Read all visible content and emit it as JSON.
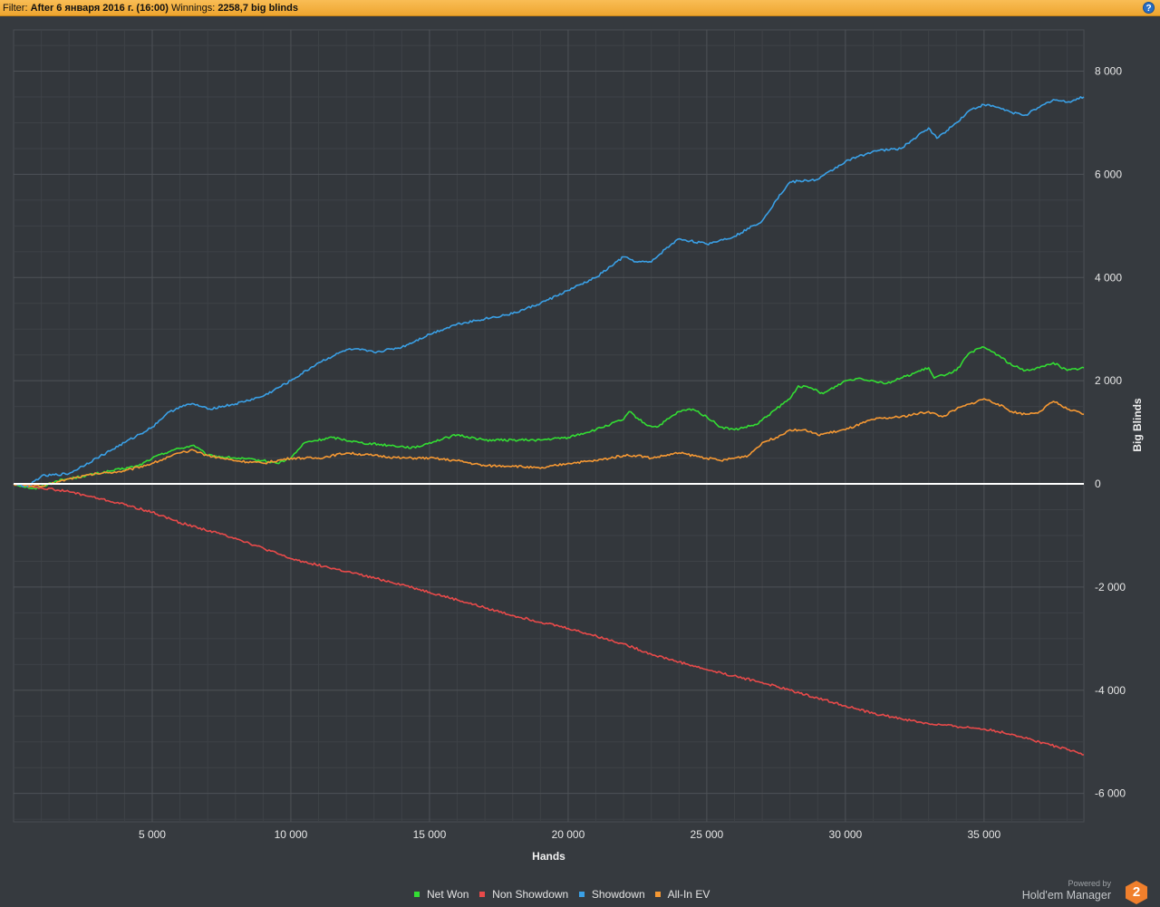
{
  "filter": {
    "label": "Filter:",
    "value": "After 6 января 2016 г. (16:00)",
    "winnings_label": "Winnings:",
    "winnings_value": "2258,7 big blinds"
  },
  "help_icon": {
    "icon": "question-icon",
    "glyph": "?"
  },
  "chart_data": {
    "type": "line",
    "title": "",
    "xlabel": "Hands",
    "ylabel": "Big Blinds",
    "xlim": [
      0,
      38600
    ],
    "ylim": [
      -6550,
      8800
    ],
    "x_ticks": [
      5000,
      10000,
      15000,
      20000,
      25000,
      30000,
      35000
    ],
    "x_tick_labels": [
      "5 000",
      "10 000",
      "15 000",
      "20 000",
      "25 000",
      "30 000",
      "35 000"
    ],
    "y_ticks": [
      8000,
      6000,
      4000,
      2000,
      0,
      -2000,
      -4000,
      -6000
    ],
    "y_tick_labels": [
      "8 000",
      "6 000",
      "4 000",
      "2 000",
      "0",
      "-2 000",
      "-4 000",
      "-6 000"
    ],
    "grid": true,
    "legend_position": "bottom",
    "series": [
      {
        "name": "Net Won",
        "color": "#33dd33",
        "points": [
          [
            0,
            0
          ],
          [
            800,
            -100
          ],
          [
            1500,
            50
          ],
          [
            2500,
            150
          ],
          [
            3500,
            250
          ],
          [
            4500,
            350
          ],
          [
            5000,
            500
          ],
          [
            5700,
            650
          ],
          [
            6500,
            750
          ],
          [
            7000,
            550
          ],
          [
            8000,
            500
          ],
          [
            9000,
            450
          ],
          [
            9500,
            400
          ],
          [
            10000,
            500
          ],
          [
            10500,
            800
          ],
          [
            11500,
            900
          ],
          [
            12500,
            800
          ],
          [
            13500,
            750
          ],
          [
            14500,
            700
          ],
          [
            15000,
            800
          ],
          [
            16000,
            950
          ],
          [
            17000,
            850
          ],
          [
            18000,
            850
          ],
          [
            19000,
            850
          ],
          [
            20000,
            900
          ],
          [
            21000,
            1050
          ],
          [
            22000,
            1250
          ],
          [
            22200,
            1400
          ],
          [
            22800,
            1150
          ],
          [
            23200,
            1100
          ],
          [
            24000,
            1400
          ],
          [
            24500,
            1450
          ],
          [
            25000,
            1300
          ],
          [
            25500,
            1100
          ],
          [
            26000,
            1050
          ],
          [
            26800,
            1150
          ],
          [
            27500,
            1450
          ],
          [
            28000,
            1650
          ],
          [
            28300,
            1900
          ],
          [
            28800,
            1850
          ],
          [
            29200,
            1750
          ],
          [
            30000,
            2000
          ],
          [
            30500,
            2050
          ],
          [
            31000,
            2000
          ],
          [
            31500,
            1950
          ],
          [
            32000,
            2050
          ],
          [
            33000,
            2250
          ],
          [
            33200,
            2050
          ],
          [
            34000,
            2200
          ],
          [
            34500,
            2550
          ],
          [
            35000,
            2650
          ],
          [
            35500,
            2500
          ],
          [
            36000,
            2300
          ],
          [
            36500,
            2200
          ],
          [
            37000,
            2250
          ],
          [
            37500,
            2350
          ],
          [
            38000,
            2200
          ],
          [
            38600,
            2250
          ]
        ]
      },
      {
        "name": "Non Showdown",
        "color": "#e84a4a",
        "points": [
          [
            0,
            0
          ],
          [
            2000,
            -150
          ],
          [
            4000,
            -400
          ],
          [
            5000,
            -550
          ],
          [
            6000,
            -750
          ],
          [
            8000,
            -1050
          ],
          [
            10000,
            -1450
          ],
          [
            12000,
            -1700
          ],
          [
            14000,
            -1950
          ],
          [
            15000,
            -2100
          ],
          [
            16000,
            -2250
          ],
          [
            18000,
            -2550
          ],
          [
            20000,
            -2800
          ],
          [
            22000,
            -3100
          ],
          [
            23000,
            -3300
          ],
          [
            24000,
            -3450
          ],
          [
            25000,
            -3600
          ],
          [
            27000,
            -3850
          ],
          [
            28000,
            -4000
          ],
          [
            29000,
            -4150
          ],
          [
            30000,
            -4300
          ],
          [
            31000,
            -4450
          ],
          [
            32000,
            -4550
          ],
          [
            33000,
            -4650
          ],
          [
            34000,
            -4700
          ],
          [
            35000,
            -4750
          ],
          [
            36000,
            -4850
          ],
          [
            37000,
            -5000
          ],
          [
            38000,
            -5150
          ],
          [
            38600,
            -5250
          ]
        ]
      },
      {
        "name": "Showdown",
        "color": "#3aa0e6",
        "points": [
          [
            0,
            0
          ],
          [
            500,
            -50
          ],
          [
            1000,
            150
          ],
          [
            2000,
            200
          ],
          [
            3000,
            500
          ],
          [
            4000,
            800
          ],
          [
            5000,
            1100
          ],
          [
            5500,
            1350
          ],
          [
            6000,
            1500
          ],
          [
            6500,
            1550
          ],
          [
            7000,
            1450
          ],
          [
            8000,
            1550
          ],
          [
            9000,
            1700
          ],
          [
            10000,
            2000
          ],
          [
            11000,
            2350
          ],
          [
            12000,
            2600
          ],
          [
            12500,
            2600
          ],
          [
            13000,
            2550
          ],
          [
            14000,
            2650
          ],
          [
            15000,
            2900
          ],
          [
            16000,
            3100
          ],
          [
            17000,
            3200
          ],
          [
            18000,
            3300
          ],
          [
            19000,
            3500
          ],
          [
            20000,
            3750
          ],
          [
            21000,
            4000
          ],
          [
            22000,
            4400
          ],
          [
            22500,
            4300
          ],
          [
            23000,
            4300
          ],
          [
            23500,
            4550
          ],
          [
            24000,
            4750
          ],
          [
            25000,
            4650
          ],
          [
            26000,
            4800
          ],
          [
            27000,
            5100
          ],
          [
            27500,
            5500
          ],
          [
            28000,
            5850
          ],
          [
            29000,
            5900
          ],
          [
            30000,
            6250
          ],
          [
            31000,
            6450
          ],
          [
            32000,
            6500
          ],
          [
            33000,
            6900
          ],
          [
            33300,
            6700
          ],
          [
            34000,
            7000
          ],
          [
            34500,
            7250
          ],
          [
            35000,
            7350
          ],
          [
            35500,
            7300
          ],
          [
            36000,
            7200
          ],
          [
            36500,
            7150
          ],
          [
            37000,
            7300
          ],
          [
            37500,
            7450
          ],
          [
            38000,
            7400
          ],
          [
            38600,
            7500
          ]
        ]
      },
      {
        "name": "All-In EV",
        "color": "#f59833",
        "points": [
          [
            0,
            0
          ],
          [
            1000,
            -50
          ],
          [
            2000,
            100
          ],
          [
            3000,
            200
          ],
          [
            4000,
            250
          ],
          [
            5000,
            400
          ],
          [
            6000,
            600
          ],
          [
            6500,
            650
          ],
          [
            7000,
            550
          ],
          [
            8000,
            450
          ],
          [
            9000,
            400
          ],
          [
            10000,
            500
          ],
          [
            11000,
            500
          ],
          [
            12000,
            600
          ],
          [
            13000,
            550
          ],
          [
            14000,
            500
          ],
          [
            15000,
            500
          ],
          [
            16000,
            450
          ],
          [
            17000,
            350
          ],
          [
            18000,
            350
          ],
          [
            19000,
            300
          ],
          [
            20000,
            400
          ],
          [
            21000,
            450
          ],
          [
            22000,
            550
          ],
          [
            22500,
            550
          ],
          [
            23000,
            500
          ],
          [
            24000,
            600
          ],
          [
            25000,
            500
          ],
          [
            25500,
            450
          ],
          [
            26500,
            550
          ],
          [
            27000,
            800
          ],
          [
            27500,
            900
          ],
          [
            28000,
            1050
          ],
          [
            28500,
            1050
          ],
          [
            29000,
            950
          ],
          [
            30000,
            1050
          ],
          [
            31000,
            1250
          ],
          [
            32000,
            1300
          ],
          [
            33000,
            1400
          ],
          [
            33500,
            1300
          ],
          [
            34000,
            1450
          ],
          [
            34500,
            1550
          ],
          [
            35000,
            1650
          ],
          [
            35500,
            1550
          ],
          [
            36000,
            1400
          ],
          [
            36500,
            1350
          ],
          [
            37000,
            1400
          ],
          [
            37500,
            1600
          ],
          [
            38000,
            1450
          ],
          [
            38600,
            1350
          ]
        ]
      }
    ]
  },
  "legend": [
    {
      "label": "Net Won",
      "color": "#33dd33"
    },
    {
      "label": "Non Showdown",
      "color": "#e84a4a"
    },
    {
      "label": "Showdown",
      "color": "#3aa0e6"
    },
    {
      "label": "All-In EV",
      "color": "#f59833"
    }
  ],
  "branding": {
    "powered_by": "Powered by",
    "product": "Hold'em Manager",
    "logo_text": "2"
  }
}
